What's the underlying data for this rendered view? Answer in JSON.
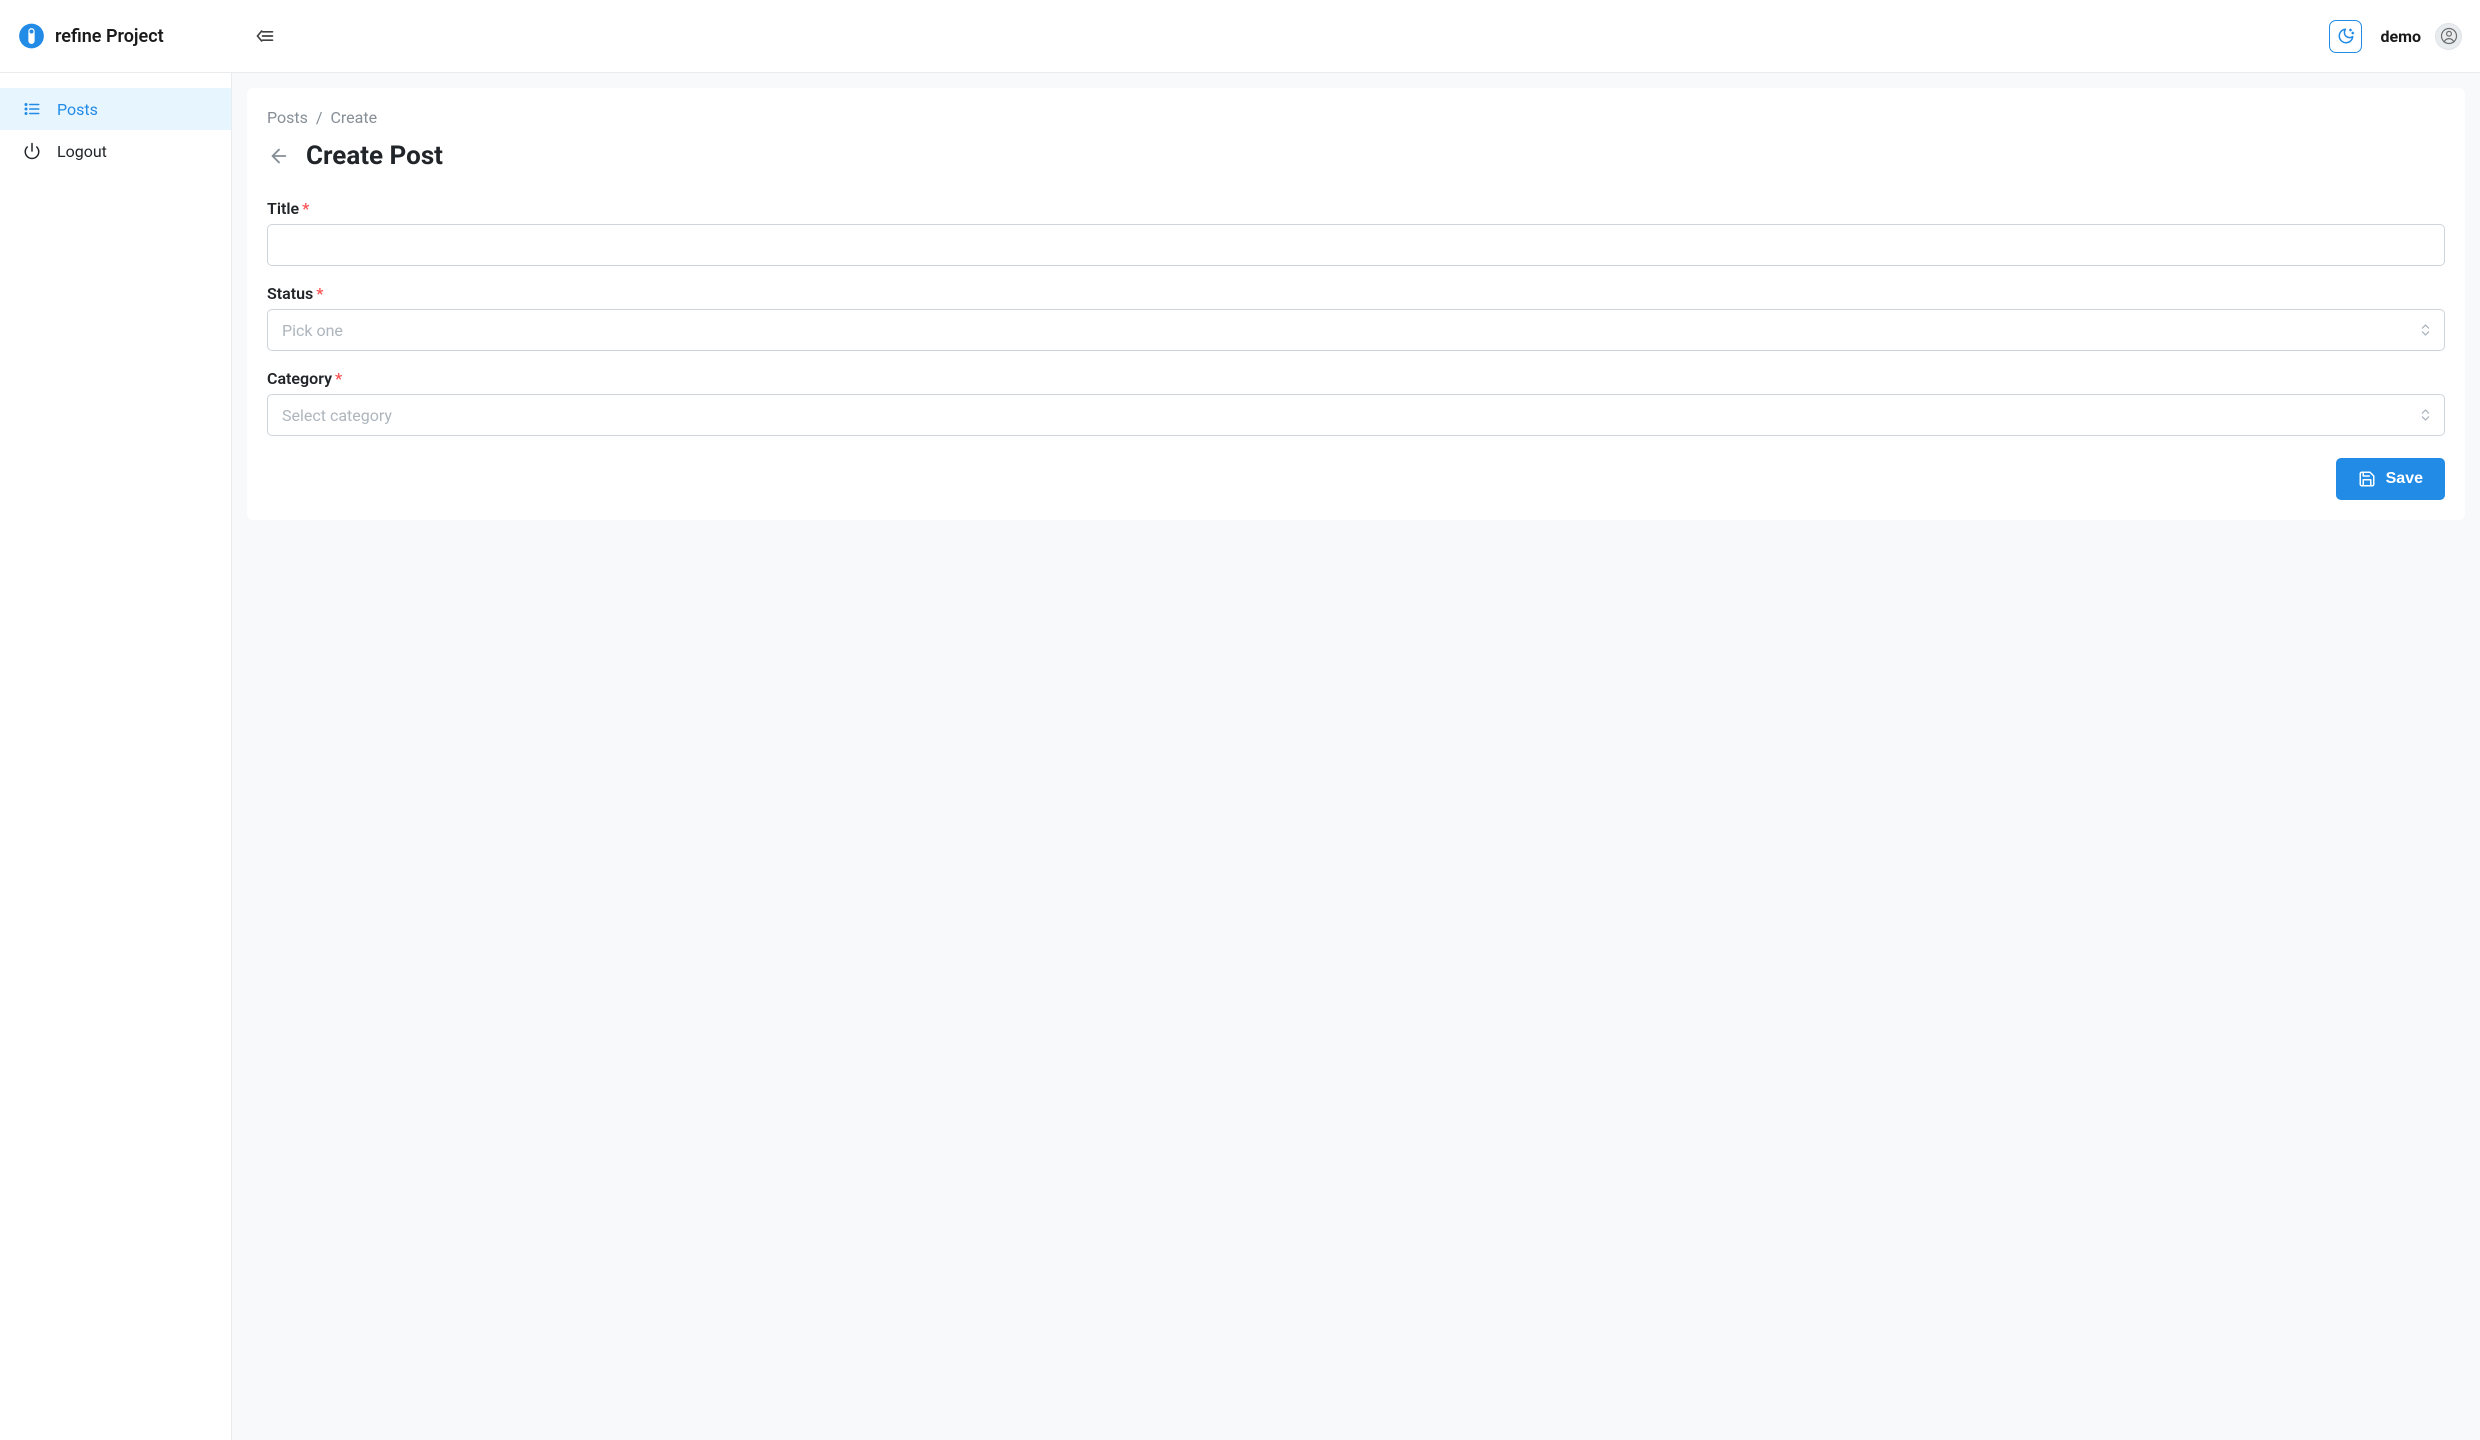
{
  "brand": {
    "name": "refine Project"
  },
  "user": {
    "name": "demo"
  },
  "sidebar": {
    "items": [
      {
        "label": "Posts",
        "icon": "list-icon",
        "active": true
      },
      {
        "label": "Logout",
        "icon": "power-icon",
        "active": false
      }
    ]
  },
  "breadcrumb": [
    {
      "label": "Posts"
    },
    {
      "label": "Create"
    }
  ],
  "page": {
    "title": "Create Post"
  },
  "form": {
    "title": {
      "label": "Title",
      "value": "",
      "required": true
    },
    "status": {
      "label": "Status",
      "placeholder": "Pick one",
      "required": true
    },
    "category": {
      "label": "Category",
      "placeholder": "Select category",
      "required": true
    }
  },
  "buttons": {
    "save": "Save"
  },
  "colors": {
    "primary": "#228be6"
  }
}
